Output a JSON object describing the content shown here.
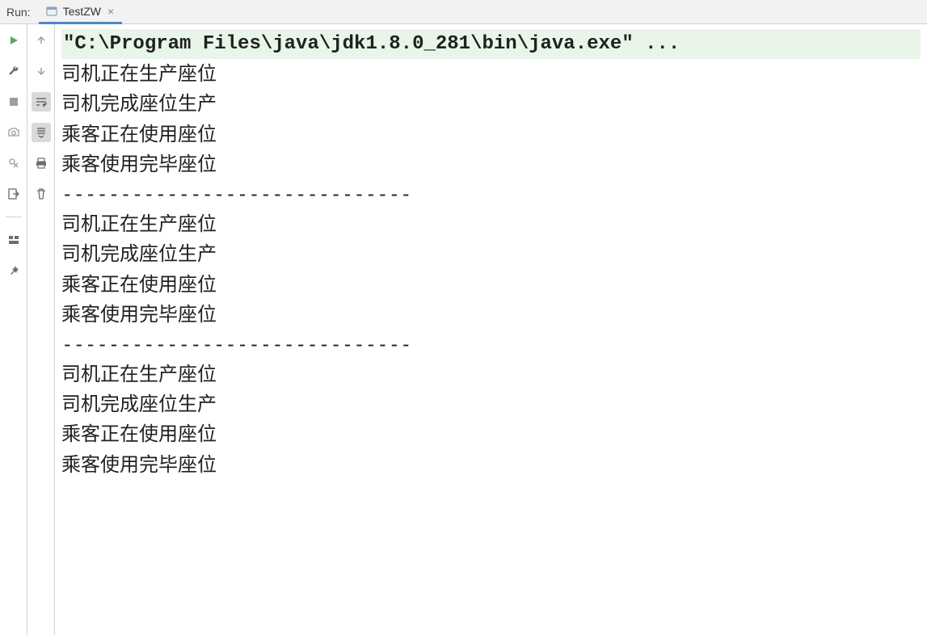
{
  "header": {
    "run_label": "Run:",
    "tab": {
      "label": "TestZW",
      "close": "×"
    }
  },
  "toolbar_left": {
    "run": "run-icon",
    "wrench": "wrench-icon",
    "stop": "stop-icon",
    "camera": "camera-icon",
    "bug_x": "disconnect-icon",
    "exit": "exit-icon",
    "layout": "layout-icon",
    "pin": "pin-icon"
  },
  "toolbar_right": {
    "up": "up-arrow-icon",
    "down": "down-arrow-icon",
    "wrap": "soft-wrap-icon",
    "scroll_end": "scroll-to-end-icon",
    "print": "print-icon",
    "trash": "trash-icon"
  },
  "console": {
    "lines": [
      {
        "text": "\"C:\\Program Files\\java\\jdk1.8.0_281\\bin\\java.exe\" ...",
        "cmd": true
      },
      {
        "text": "司机正在生产座位"
      },
      {
        "text": "司机完成座位生产"
      },
      {
        "text": "乘客正在使用座位"
      },
      {
        "text": "乘客使用完毕座位"
      },
      {
        "text": "------------------------------"
      },
      {
        "text": "司机正在生产座位"
      },
      {
        "text": "司机完成座位生产"
      },
      {
        "text": "乘客正在使用座位"
      },
      {
        "text": "乘客使用完毕座位"
      },
      {
        "text": "------------------------------"
      },
      {
        "text": "司机正在生产座位"
      },
      {
        "text": "司机完成座位生产"
      },
      {
        "text": "乘客正在使用座位"
      },
      {
        "text": "乘客使用完毕座位"
      }
    ]
  }
}
